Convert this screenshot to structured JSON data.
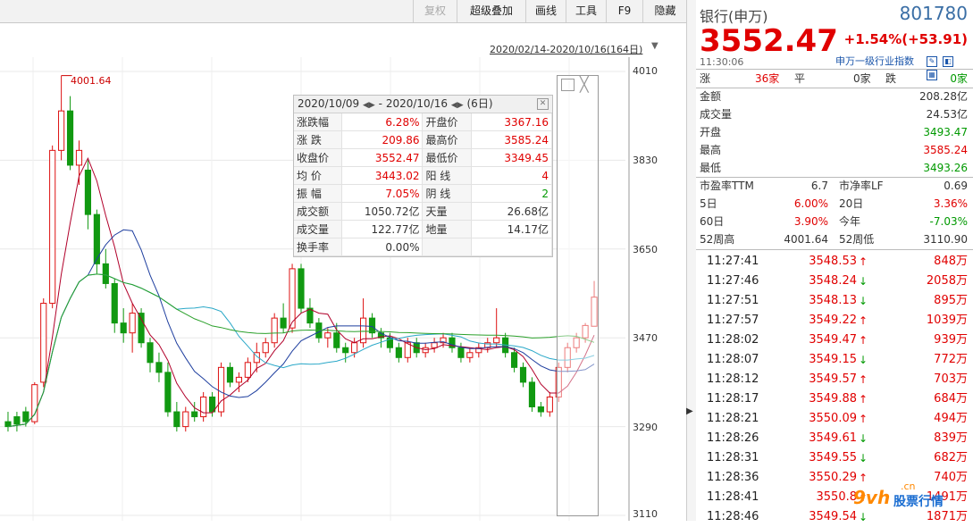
{
  "toolbar": {
    "items": [
      "复权",
      "超级叠加",
      "画线",
      "工具",
      "F9",
      "隐藏"
    ],
    "range_label": "2020/02/14-2020/10/16(164日)",
    "range_arrow": "▼"
  },
  "chart": {
    "y_labels": [
      "4010",
      "3830",
      "3650",
      "3470",
      "3290",
      "3110"
    ],
    "max_label": "4001.64",
    "ylim": [
      3110,
      4010
    ],
    "colors": {
      "up": "#dd1111",
      "down": "#119911",
      "ma5": "#b1002a",
      "ma10": "#1f3f9f",
      "ma20": "#2aa8c8",
      "ma60": "#2aa02a"
    }
  },
  "chart_data": {
    "type": "candlestick",
    "y_axis_ticks": [
      4010,
      3830,
      3650,
      3470,
      3290,
      3110
    ],
    "ylim": [
      3110,
      4010
    ],
    "annotations": [
      {
        "text": "4001.64",
        "value": 4001.64
      }
    ],
    "candles": [
      [
        3300,
        3320,
        3280,
        3290
      ],
      [
        3310,
        3320,
        3280,
        3295
      ],
      [
        3320,
        3330,
        3290,
        3300
      ],
      [
        3300,
        3380,
        3295,
        3375
      ],
      [
        3380,
        3550,
        3370,
        3540
      ],
      [
        3540,
        3860,
        3530,
        3850
      ],
      [
        3850,
        4001.64,
        3830,
        3930
      ],
      [
        3930,
        3960,
        3810,
        3820
      ],
      [
        3820,
        3870,
        3780,
        3850
      ],
      [
        3810,
        3830,
        3690,
        3720
      ],
      [
        3720,
        3730,
        3600,
        3620
      ],
      [
        3620,
        3650,
        3570,
        3580
      ],
      [
        3580,
        3590,
        3480,
        3500
      ],
      [
        3500,
        3530,
        3460,
        3480
      ],
      [
        3480,
        3540,
        3440,
        3520
      ],
      [
        3520,
        3530,
        3450,
        3460
      ],
      [
        3460,
        3470,
        3400,
        3420
      ],
      [
        3420,
        3440,
        3380,
        3400
      ],
      [
        3400,
        3420,
        3310,
        3320
      ],
      [
        3320,
        3340,
        3280,
        3290
      ],
      [
        3290,
        3330,
        3280,
        3320
      ],
      [
        3320,
        3340,
        3300,
        3310
      ],
      [
        3310,
        3360,
        3300,
        3350
      ],
      [
        3350,
        3360,
        3310,
        3320
      ],
      [
        3320,
        3420,
        3310,
        3410
      ],
      [
        3410,
        3420,
        3370,
        3380
      ],
      [
        3380,
        3400,
        3360,
        3390
      ],
      [
        3390,
        3430,
        3380,
        3420
      ],
      [
        3420,
        3460,
        3400,
        3440
      ],
      [
        3440,
        3470,
        3430,
        3460
      ],
      [
        3460,
        3520,
        3450,
        3510
      ],
      [
        3510,
        3540,
        3480,
        3490
      ],
      [
        3490,
        3620,
        3480,
        3610
      ],
      [
        3610,
        3620,
        3520,
        3530
      ],
      [
        3530,
        3550,
        3490,
        3500
      ],
      [
        3500,
        3510,
        3460,
        3470
      ],
      [
        3470,
        3490,
        3450,
        3480
      ],
      [
        3480,
        3500,
        3440,
        3450
      ],
      [
        3450,
        3460,
        3420,
        3440
      ],
      [
        3440,
        3470,
        3430,
        3460
      ],
      [
        3460,
        3550,
        3450,
        3510
      ],
      [
        3510,
        3520,
        3470,
        3480
      ],
      [
        3480,
        3490,
        3450,
        3470
      ],
      [
        3470,
        3480,
        3440,
        3450
      ],
      [
        3450,
        3460,
        3420,
        3430
      ],
      [
        3430,
        3470,
        3420,
        3460
      ],
      [
        3460,
        3470,
        3430,
        3440
      ],
      [
        3440,
        3460,
        3430,
        3450
      ],
      [
        3450,
        3470,
        3440,
        3460
      ],
      [
        3460,
        3480,
        3450,
        3470
      ],
      [
        3470,
        3480,
        3440,
        3450
      ],
      [
        3450,
        3460,
        3420,
        3430
      ],
      [
        3430,
        3450,
        3420,
        3440
      ],
      [
        3440,
        3460,
        3430,
        3450
      ],
      [
        3450,
        3470,
        3440,
        3460
      ],
      [
        3460,
        3530,
        3450,
        3470
      ],
      [
        3470,
        3480,
        3430,
        3440
      ],
      [
        3440,
        3450,
        3400,
        3410
      ],
      [
        3410,
        3420,
        3370,
        3380
      ],
      [
        3380,
        3390,
        3320,
        3330
      ],
      [
        3330,
        3340,
        3310,
        3320
      ],
      [
        3320,
        3360,
        3310,
        3350
      ],
      [
        3350,
        3420,
        3340,
        3410
      ],
      [
        3410,
        3460,
        3400,
        3450
      ],
      [
        3450,
        3480,
        3440,
        3470
      ],
      [
        3470,
        3500,
        3460,
        3495
      ],
      [
        3493.47,
        3585.24,
        3493.26,
        3552.47
      ]
    ],
    "series": [
      {
        "name": "MA5"
      },
      {
        "name": "MA10"
      },
      {
        "name": "MA20"
      },
      {
        "name": "MA60"
      }
    ]
  },
  "popup": {
    "date_from": "2020/10/09",
    "date_to": "2020/10/16",
    "days": "(6日)",
    "rows": [
      [
        "涨跌幅",
        "6.28%",
        "开盘价",
        "3367.16"
      ],
      [
        "涨 跌",
        "209.86",
        "最高价",
        "3585.24"
      ],
      [
        "收盘价",
        "3552.47",
        "最低价",
        "3349.45"
      ],
      [
        "均 价",
        "3443.02",
        "阳 线",
        "4"
      ],
      [
        "振 幅",
        "7.05%",
        "阴 线",
        "2"
      ],
      [
        "成交额",
        "1050.72亿",
        "天量",
        "26.68亿"
      ],
      [
        "成交量",
        "122.77亿",
        "地量",
        "14.17亿"
      ],
      [
        "换手率",
        "0.00%",
        "",
        ""
      ]
    ]
  },
  "quote": {
    "name": "银行(申万)",
    "code": "801780",
    "price": "3552.47",
    "change": "+1.54%(+53.91)",
    "time": "11:30:06",
    "index_link": "申万一级行业指数",
    "breadth": {
      "up_label": "涨",
      "up": "36家",
      "flat_label": "平",
      "flat": "0家",
      "down_label": "跌",
      "down": "0家"
    },
    "stats": [
      [
        "金额",
        "208.28亿"
      ],
      [
        "成交量",
        "24.53亿"
      ],
      [
        "开盘",
        "3493.47"
      ],
      [
        "最高",
        "3585.24"
      ],
      [
        "最低",
        "3493.26"
      ]
    ],
    "stats2": [
      [
        "市盈率TTM",
        "6.7",
        "市净率LF",
        "0.69"
      ],
      [
        "5日",
        "6.00%",
        "20日",
        "3.36%"
      ],
      [
        "60日",
        "3.90%",
        "今年",
        "-7.03%"
      ],
      [
        "52周高",
        "4001.64",
        "52周低",
        "3110.90"
      ]
    ]
  },
  "ticks": [
    [
      "11:27:41",
      "3548.53",
      "up",
      "848万"
    ],
    [
      "11:27:46",
      "3548.24",
      "down",
      "2058万"
    ],
    [
      "11:27:51",
      "3548.13",
      "down",
      "895万"
    ],
    [
      "11:27:57",
      "3549.22",
      "up",
      "1039万"
    ],
    [
      "11:28:02",
      "3549.47",
      "up",
      "939万"
    ],
    [
      "11:28:07",
      "3549.15",
      "down",
      "772万"
    ],
    [
      "11:28:12",
      "3549.57",
      "up",
      "703万"
    ],
    [
      "11:28:17",
      "3549.88",
      "up",
      "684万"
    ],
    [
      "11:28:21",
      "3550.09",
      "up",
      "494万"
    ],
    [
      "11:28:26",
      "3549.61",
      "down",
      "839万"
    ],
    [
      "11:28:31",
      "3549.55",
      "down",
      "682万"
    ],
    [
      "11:28:36",
      "3550.29",
      "up",
      "740万"
    ],
    [
      "11:28:41",
      "3550.8",
      "up",
      "1491万"
    ],
    [
      "11:28:46",
      "3549.54",
      "down",
      "1871万"
    ]
  ],
  "watermark": {
    "logo": "9vh",
    "text": "股票行情",
    "domain": ".cn"
  }
}
